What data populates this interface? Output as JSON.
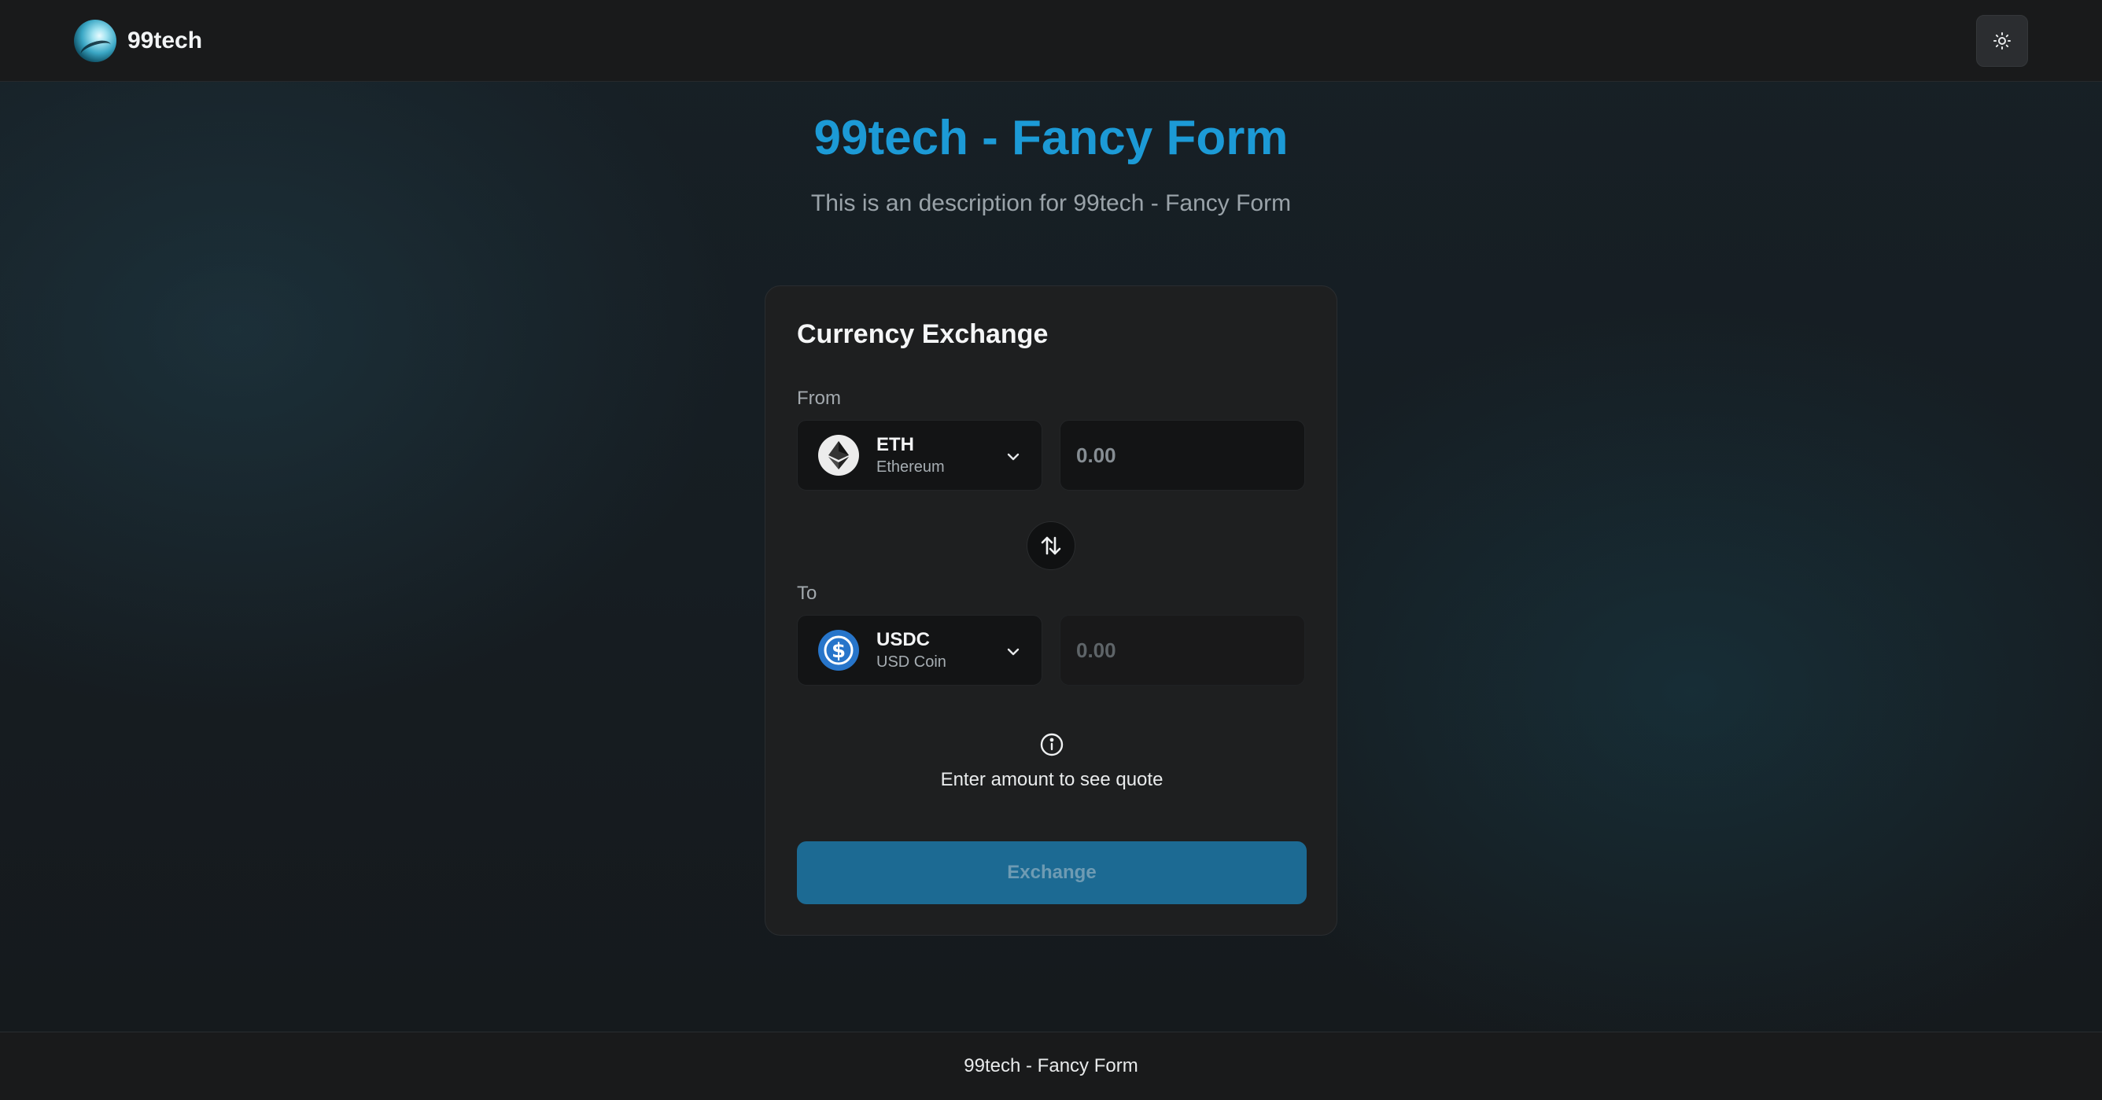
{
  "header": {
    "brand_name": "99tech",
    "logo_icon": "globe-logo",
    "theme_toggle_icon": "sun-icon"
  },
  "hero": {
    "title": "99tech - Fancy Form",
    "subtitle": "This is an description for 99tech - Fancy Form"
  },
  "form": {
    "title": "Currency Exchange",
    "from": {
      "label": "From",
      "token_symbol": "ETH",
      "token_name": "Ethereum",
      "token_icon": "ethereum-icon",
      "amount_placeholder": "0.00"
    },
    "swap_icon": "swap-arrows-icon",
    "to": {
      "label": "To",
      "token_symbol": "USDC",
      "token_name": "USD Coin",
      "token_icon": "usdc-icon",
      "amount_placeholder": "0.00"
    },
    "quote": {
      "icon": "info-icon",
      "text": "Enter amount to see quote"
    },
    "submit_label": "Exchange"
  },
  "footer": {
    "text": "99tech - Fancy Form"
  },
  "colors": {
    "accent": "#1c9ad6",
    "button": "#1c6a93",
    "card": "#1e1f20",
    "header": "#191a1b"
  }
}
